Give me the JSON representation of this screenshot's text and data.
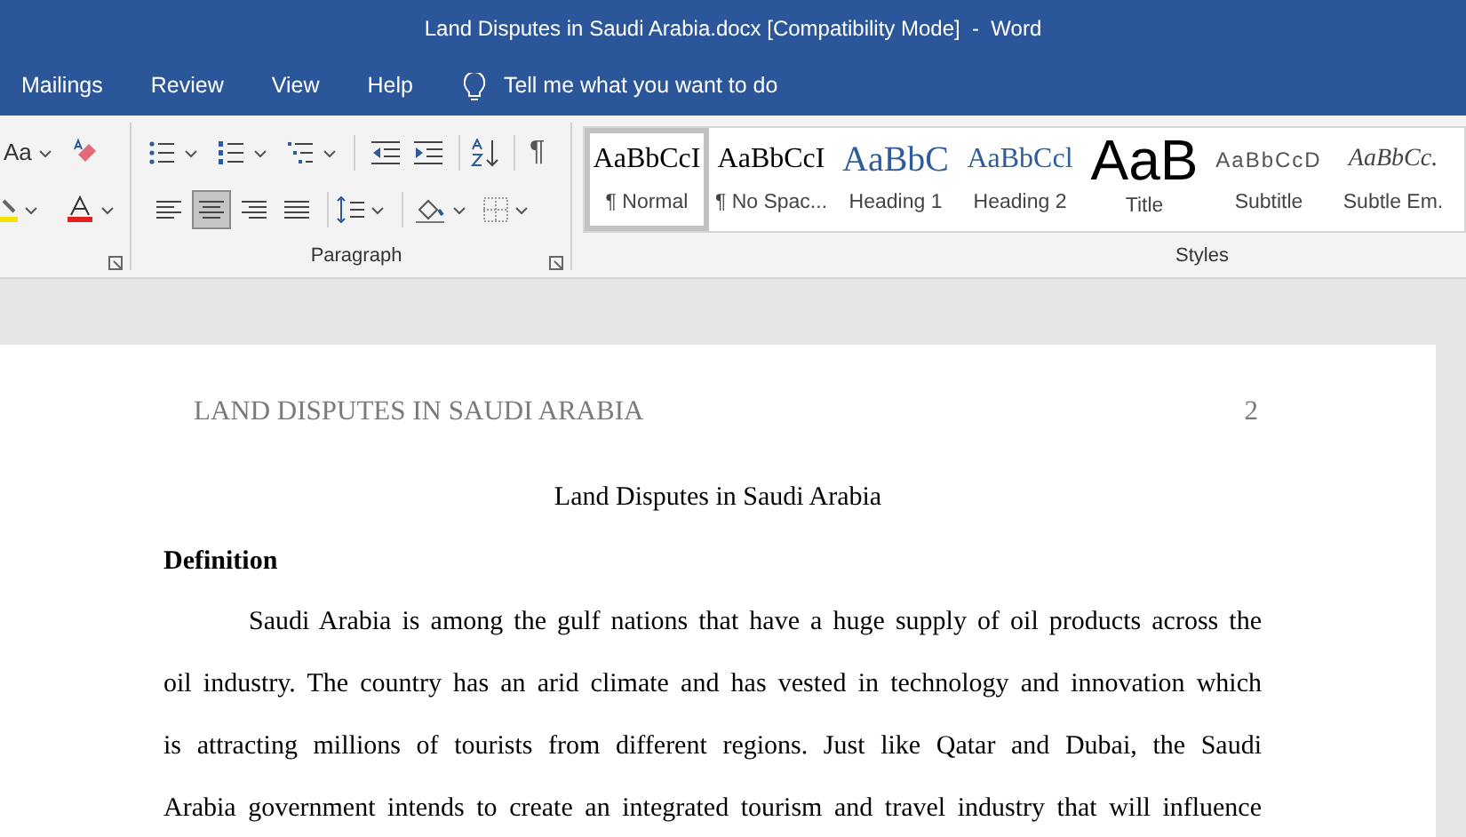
{
  "window": {
    "title": "Land Disputes in Saudi Arabia.docx [Compatibility Mode]  -  Word"
  },
  "tabs": [
    {
      "label": "Mailings"
    },
    {
      "label": "Review"
    },
    {
      "label": "View"
    },
    {
      "label": "Help"
    }
  ],
  "tell_me": {
    "placeholder": "Tell me what you want to do"
  },
  "font_group": {
    "change_case": "Aa"
  },
  "paragraph_group": {
    "label": "Paragraph",
    "pilcrow": "¶",
    "align_buttons": [
      {
        "selected": false
      },
      {
        "selected": true
      },
      {
        "selected": false
      },
      {
        "selected": false
      }
    ]
  },
  "styles_group": {
    "label": "Styles",
    "items": [
      {
        "kind": "normal",
        "preview": "AaBbCcI",
        "label": "¶ Normal",
        "selected": true
      },
      {
        "kind": "normal",
        "preview": "AaBbCcI",
        "label": "¶ No Spac...",
        "selected": false
      },
      {
        "kind": "heading1",
        "preview": "AaBbC",
        "label": "Heading 1",
        "selected": false
      },
      {
        "kind": "heading2",
        "preview": "AaBbCcl",
        "label": "Heading 2",
        "selected": false
      },
      {
        "kind": "title",
        "preview": "AaB",
        "label": "Title",
        "selected": false
      },
      {
        "kind": "subtitle",
        "preview": "AaBbCcD",
        "label": "Subtitle",
        "selected": false
      },
      {
        "kind": "emphasis",
        "preview": "AaBbCc.",
        "label": "Subtle Em.",
        "selected": false
      }
    ]
  },
  "document": {
    "running_head": "LAND DISPUTES IN SAUDI ARABIA",
    "page_number": "2",
    "title": "Land Disputes in Saudi Arabia",
    "heading": "Definition",
    "paragraph_lines": [
      "Saudi Arabia is among the gulf nations that have a huge supply of oil products across the",
      "oil industry. The country has an arid climate and has vested in technology and innovation which",
      "is attracting millions of tourists from different regions. Just like Qatar and Dubai, the Saudi",
      "Arabia government intends to create an integrated tourism and travel industry that will influence"
    ]
  }
}
